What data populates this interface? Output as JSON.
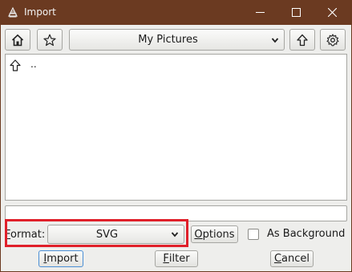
{
  "window": {
    "title": "Import",
    "icon": "inkscape-icon",
    "controls": [
      "minimize-icon",
      "maximize-icon",
      "close-icon"
    ]
  },
  "toolbar": {
    "home_icon": "home-icon",
    "bookmark_icon": "star-icon",
    "location": "My Pictures",
    "up_icon": "up-arrow-icon",
    "settings_icon": "gear-icon"
  },
  "files": [
    {
      "icon": "up-arrow-icon",
      "name": ".."
    }
  ],
  "path_entry": {
    "value": ""
  },
  "format": {
    "label": "Format:",
    "selected": "SVG",
    "label_underline": "F",
    "label_rest": "ormat:"
  },
  "options_button": {
    "underline": "O",
    "rest": "ptions"
  },
  "as_background": {
    "label": "As Background",
    "checked": false
  },
  "buttons": {
    "import": {
      "underline": "I",
      "rest": "mport"
    },
    "filter": {
      "underline": "F",
      "rest": "ilter"
    },
    "cancel": {
      "underline": "C",
      "rest": "ancel"
    }
  },
  "colors": {
    "titlebar": "#6b3a21",
    "highlight": "#e0202a",
    "default_button_border": "#4a8fd6"
  }
}
